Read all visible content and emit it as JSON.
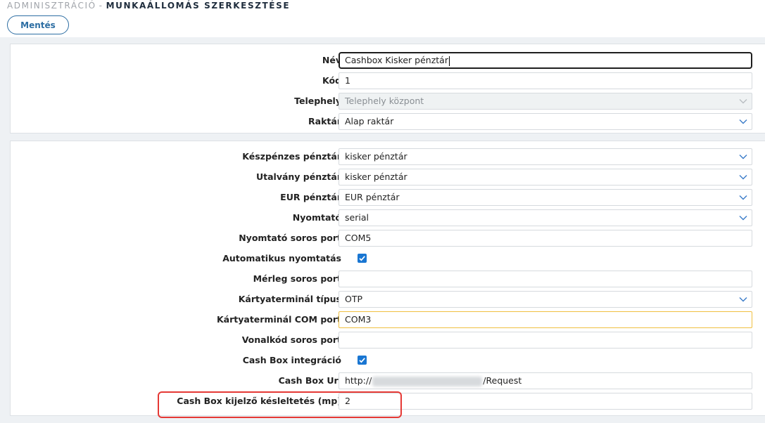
{
  "breadcrumb": {
    "parent": "ADMINISZTRÁCIÓ",
    "separator": "-",
    "current": "MUNKAÁLLOMÁS SZERKESZTÉSE"
  },
  "toolbar": {
    "save_label": "Mentés"
  },
  "section1": {
    "nev": {
      "label": "Név",
      "value": "Cashbox Kisker pénztár"
    },
    "kod": {
      "label": "Kód",
      "value": "1"
    },
    "telephely": {
      "label": "Telephely",
      "value": "Telephely központ",
      "disabled": true
    },
    "raktar": {
      "label": "Raktár",
      "value": "Alap raktár"
    }
  },
  "section2": {
    "keszpenzes_penztar": {
      "label": "Készpénzes pénztár",
      "value": "kisker pénztár"
    },
    "utalvany_penztar": {
      "label": "Utalvány pénztár",
      "value": "kisker pénztár"
    },
    "eur_penztar": {
      "label": "EUR pénztár",
      "value": "EUR pénztár"
    },
    "nyomtato": {
      "label": "Nyomtató",
      "value": "serial"
    },
    "nyomtato_soros_port": {
      "label": "Nyomtató soros port",
      "value": "COM5"
    },
    "automatikus_nyomtatas": {
      "label": "Automatikus nyomtatás",
      "checked": true
    },
    "merleg_soros_port": {
      "label": "Mérleg soros port",
      "value": ""
    },
    "kartyaterminal_tipus": {
      "label": "Kártyaterminál típus",
      "value": "OTP"
    },
    "kartyaterminal_com_port": {
      "label": "Kártyaterminál COM port",
      "value": "COM3"
    },
    "vonalkod_soros_port": {
      "label": "Vonalkód soros port",
      "value": ""
    },
    "cash_box_integracio": {
      "label": "Cash Box integráció",
      "checked": true
    },
    "cash_box_url": {
      "label": "Cash Box Url",
      "prefix": "http://",
      "suffix": "/Request"
    },
    "cash_box_kijelzo_kesleltetes": {
      "label": "Cash Box kijelző késleltetés (mp)",
      "value": "2"
    }
  },
  "colors": {
    "accent": "#2d6ea3",
    "checkbox": "#1976d2",
    "focus_border": "#f0c040",
    "highlight": "#e53935",
    "page_background": "#eef1f4"
  },
  "icons": {
    "select_arrow": "chevron-down-icon",
    "checkbox_mark": "checkmark-icon"
  }
}
